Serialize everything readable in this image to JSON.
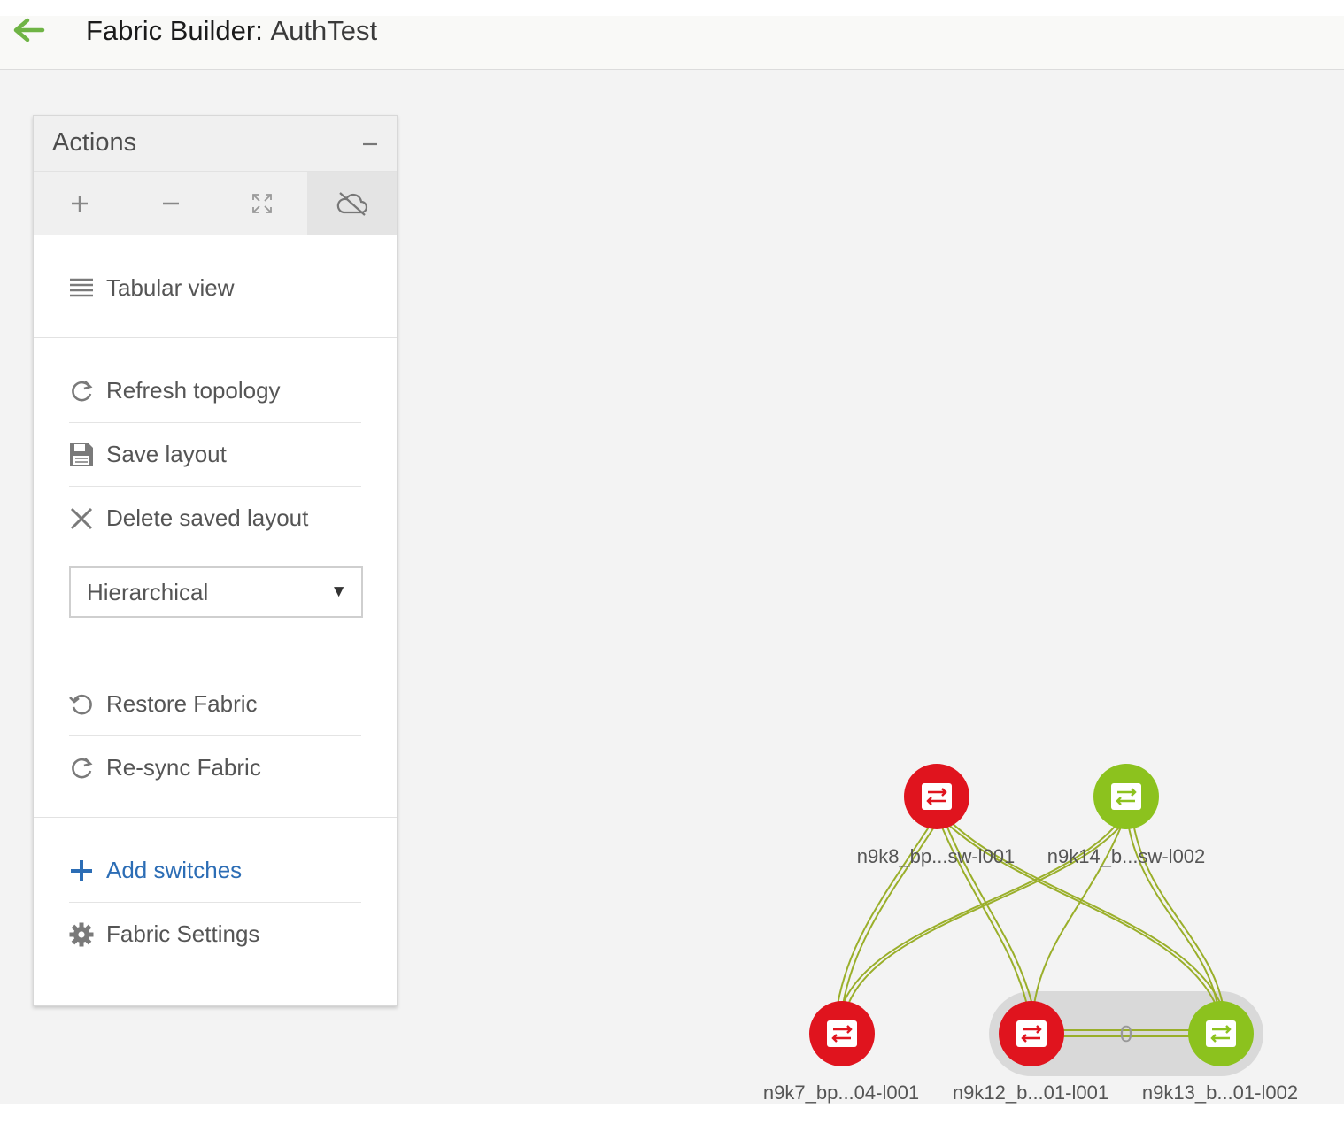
{
  "header": {
    "title_prefix": "Fabric Builder:",
    "title_name": "AuthTest"
  },
  "actions_panel": {
    "title": "Actions",
    "toolbar": {
      "zoom_in": "zoom-in-icon",
      "zoom_out": "zoom-out-icon",
      "fit": "fit-to-screen-icon",
      "cloud_toggle": "cloud-off-icon"
    },
    "tabular_view": "Tabular view",
    "refresh_topology": "Refresh topology",
    "save_layout": "Save layout",
    "delete_saved_layout": "Delete saved layout",
    "layout_select": {
      "value": "Hierarchical"
    },
    "restore_fabric": "Restore Fabric",
    "resync_fabric": "Re-sync Fabric",
    "add_switches": "Add switches",
    "fabric_settings": "Fabric Settings"
  },
  "topology": {
    "nodes": [
      {
        "label": "n9k8_bp...sw-l001",
        "status": "error",
        "tier": "spine"
      },
      {
        "label": "n9k14_b...sw-l002",
        "status": "ok",
        "tier": "spine"
      },
      {
        "label": "n9k7_bp...04-l001",
        "status": "error",
        "tier": "leaf"
      },
      {
        "label": "n9k12_b...01-l001",
        "status": "error",
        "tier": "leaf"
      },
      {
        "label": "n9k13_b...01-l002",
        "status": "ok",
        "tier": "leaf"
      }
    ],
    "vpc_pair_link_label": "0",
    "colors": {
      "error": "#e0141e",
      "ok": "#8cc21e",
      "link": "#9aaf2a",
      "vpc_group_bg": "#d9d9d9",
      "accent_back": "#6fb445",
      "link_text": "#2c6db5"
    }
  }
}
